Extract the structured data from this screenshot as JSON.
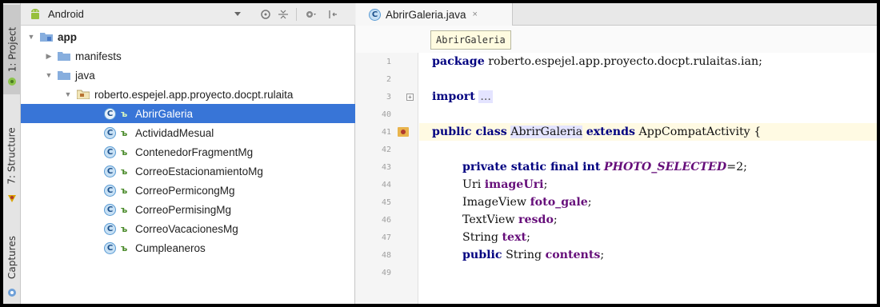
{
  "toolstrip": {
    "tabs": [
      {
        "label": "1: Project",
        "icon": "android-green-icon"
      },
      {
        "label": "7: Structure",
        "icon": "structure-icon"
      },
      {
        "label": "Captures",
        "icon": "capture-icon"
      }
    ]
  },
  "project": {
    "view_label": "Android",
    "header_icons": [
      "dropdown-arrow-icon",
      "sync-icon",
      "collapse-icon",
      "settings-icon",
      "hide-icon"
    ],
    "tree": [
      {
        "label": "app",
        "type": "module",
        "expanded": true
      },
      {
        "label": "manifests",
        "type": "folder",
        "expanded": false
      },
      {
        "label": "java",
        "type": "folder",
        "expanded": true
      },
      {
        "label": "roberto.espejel.app.proyecto.docpt.rulaita",
        "type": "package",
        "expanded": true
      },
      {
        "label": "AbrirGaleria",
        "type": "class",
        "selected": true
      },
      {
        "label": "ActividadMesual",
        "type": "class"
      },
      {
        "label": "ContenedorFragmentMg",
        "type": "class"
      },
      {
        "label": "CorreoEstacionamientoMg",
        "type": "class"
      },
      {
        "label": "CorreoPermicongMg",
        "type": "class"
      },
      {
        "label": "CorreoPermisingMg",
        "type": "class"
      },
      {
        "label": "CorreoVacacionesMg",
        "type": "class"
      },
      {
        "label": "Cumpleaneros",
        "type": "class"
      }
    ]
  },
  "editor": {
    "tab_label": "AbrirGaleria.java",
    "tab_close": "×",
    "breadcrumb": "AbrirGaleria",
    "line_numbers": [
      "1",
      "2",
      "3",
      "40",
      "41",
      "42",
      "43",
      "44",
      "45",
      "46",
      "47",
      "48",
      "49"
    ],
    "code": {
      "l1_kw": "package",
      "l1_rest": " roberto.espejel.app.proyecto.docpt.rulaitas.ian;",
      "l3_kw": "import",
      "l3_fold": "...",
      "l41_a": "public class",
      "l41_name": "AbrirGaleria",
      "l41_b": "extends",
      "l41_c": " AppCompatActivity {",
      "l43_kw": "private static final int",
      "l43_const": "PHOTO_SELECTED",
      "l43_rest": "=2;",
      "l44_type": "Uri ",
      "l44_field": "imageUri",
      "l44_end": ";",
      "l45_type": "ImageView ",
      "l45_field": "foto_gale",
      "l45_end": ";",
      "l46_type": "TextView ",
      "l46_field": "resdo",
      "l46_end": ";",
      "l47_type": "String ",
      "l47_field": "text",
      "l47_end": ";",
      "l48_kw": "public",
      "l48_type": " String ",
      "l48_field": "contents",
      "l48_end": ";"
    }
  },
  "colors": {
    "selection": "#3875d7",
    "keyword": "#000080",
    "field": "#660e7a",
    "current_line": "#fffae3"
  }
}
